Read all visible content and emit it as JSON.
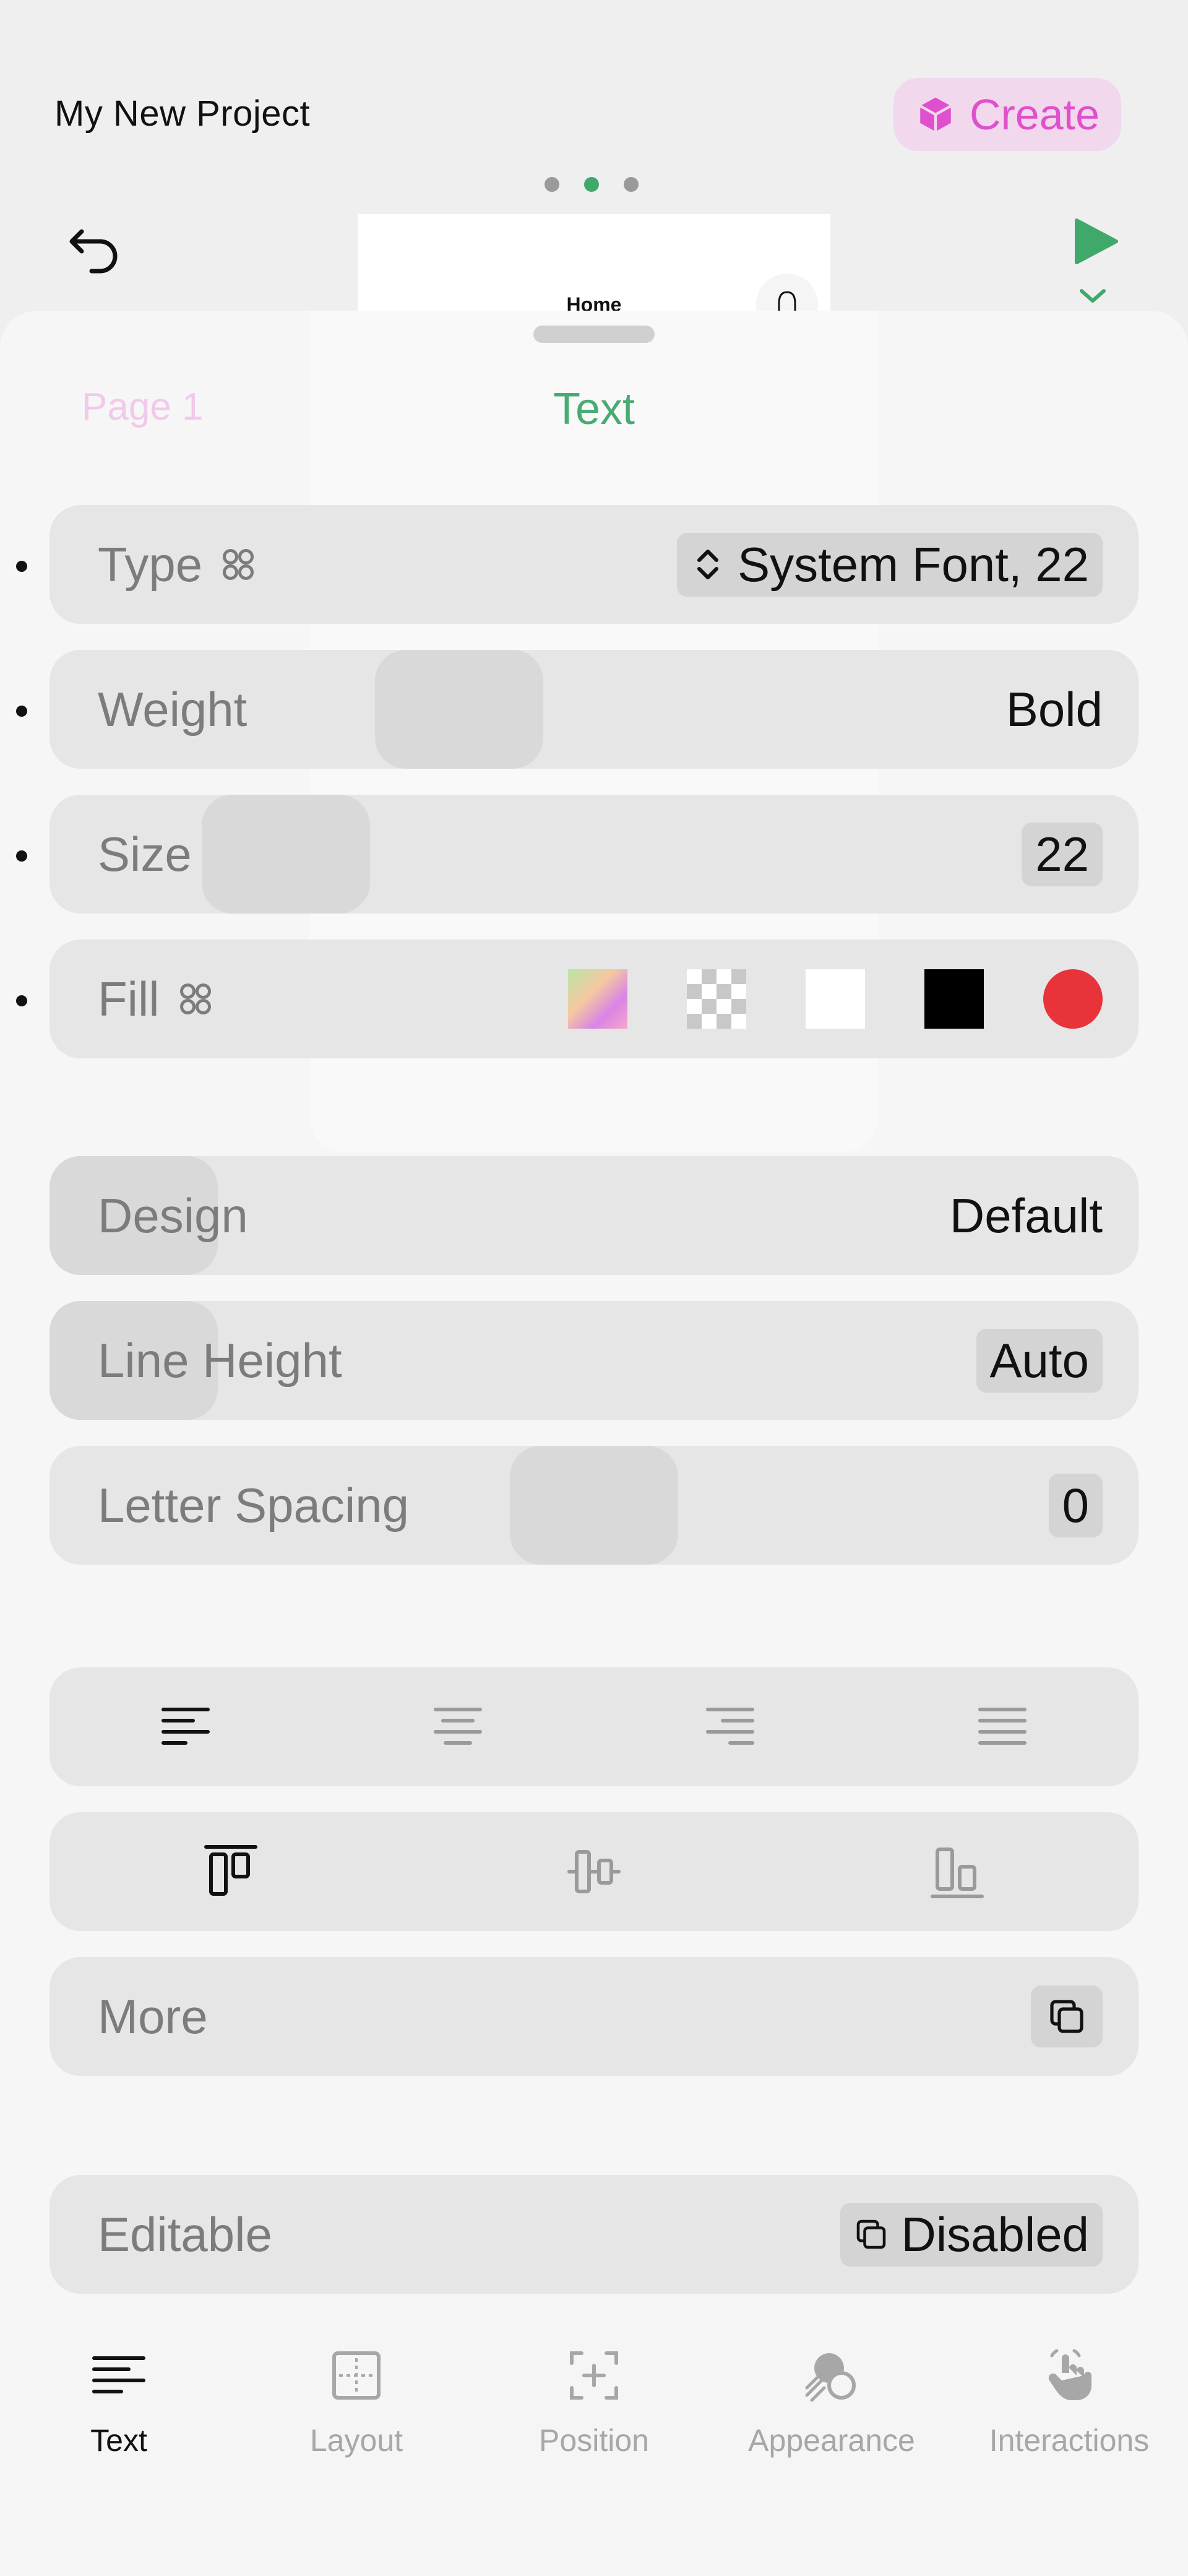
{
  "header": {
    "project_title": "My New Project",
    "create_label": "Create",
    "page_indicator_count": 3,
    "page_indicator_active": 2
  },
  "canvas": {
    "nav_title": "Home"
  },
  "sheet": {
    "tabs": {
      "page": "Page 1",
      "text": "Text"
    },
    "type": {
      "label": "Type",
      "value": "System Font, 22"
    },
    "weight": {
      "label": "Weight",
      "value": "Bold"
    },
    "size": {
      "label": "Size",
      "value": "22"
    },
    "fill": {
      "label": "Fill",
      "swatches": [
        "image",
        "clear",
        "#FFFFFF",
        "#000000",
        "#E8333B"
      ]
    },
    "design": {
      "label": "Design",
      "value": "Default"
    },
    "line_height": {
      "label": "Line Height",
      "value": "Auto"
    },
    "letter_spacing": {
      "label": "Letter Spacing",
      "value": "0"
    },
    "text_alignment": {
      "selected": "left",
      "options": [
        "left",
        "center",
        "right",
        "justify"
      ]
    },
    "vertical_alignment": {
      "selected": "top",
      "options": [
        "top",
        "middle",
        "bottom"
      ]
    },
    "more": {
      "label": "More"
    },
    "editable": {
      "label": "Editable",
      "value": "Disabled"
    }
  },
  "tabbar": {
    "items": [
      {
        "label": "Text",
        "icon": "text-lines-icon",
        "active": true
      },
      {
        "label": "Layout",
        "icon": "layout-icon",
        "active": false
      },
      {
        "label": "Position",
        "icon": "position-icon",
        "active": false
      },
      {
        "label": "Appearance",
        "icon": "appearance-icon",
        "active": false
      },
      {
        "label": "Interactions",
        "icon": "tap-hand-icon",
        "active": false
      }
    ]
  },
  "colors": {
    "accent_green": "#3FA96B",
    "create_pink": "#E04FCD",
    "create_bg": "#F1D8EC"
  }
}
